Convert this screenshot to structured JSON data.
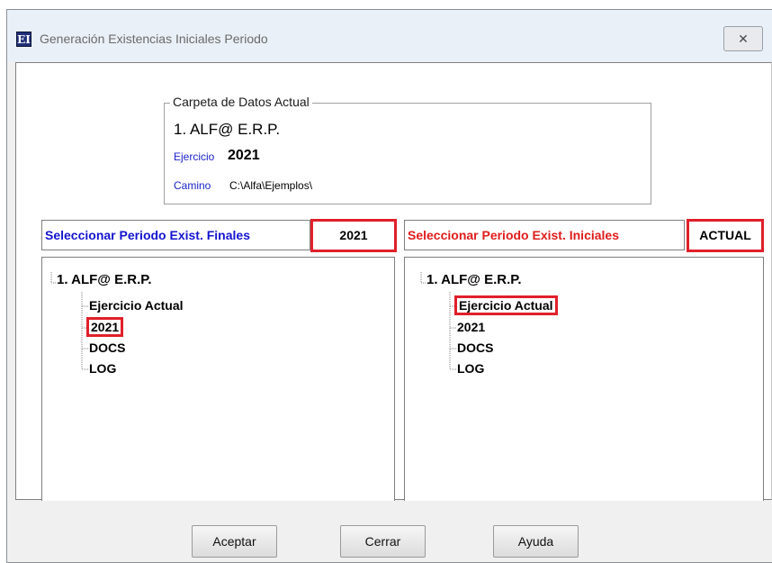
{
  "window": {
    "icon_text": "EI",
    "title": "Generación Existencias Iniciales Periodo",
    "close_glyph": "✕"
  },
  "group": {
    "legend": "Carpeta de Datos Actual",
    "company": "1. ALF@ E.R.P.",
    "ejercicio_label": "Ejercicio",
    "ejercicio_value": "2021",
    "camino_label": "Camino",
    "camino_value": "C:\\Alfa\\Ejemplos\\"
  },
  "left_panel": {
    "label": "Seleccionar Periodo Exist. Finales",
    "tab": "2021",
    "root": "1. ALF@ E.R.P.",
    "items": [
      "Ejercicio Actual",
      "2021",
      "DOCS",
      "LOG"
    ],
    "highlighted": "2021"
  },
  "right_panel": {
    "label": "Seleccionar Periodo Exist. Iniciales",
    "tab": "ACTUAL",
    "root": "1. ALF@ E.R.P.",
    "items": [
      "Ejercicio Actual",
      "2021",
      "DOCS",
      "LOG"
    ],
    "highlighted": "Ejercicio Actual"
  },
  "buttons": {
    "accept": "Aceptar",
    "close": "Cerrar",
    "help": "Ayuda"
  },
  "colors": {
    "highlight": "#e0202a",
    "left_label": "#1414d0",
    "right_label": "#e01c1c",
    "link_label": "#1a24c8"
  }
}
